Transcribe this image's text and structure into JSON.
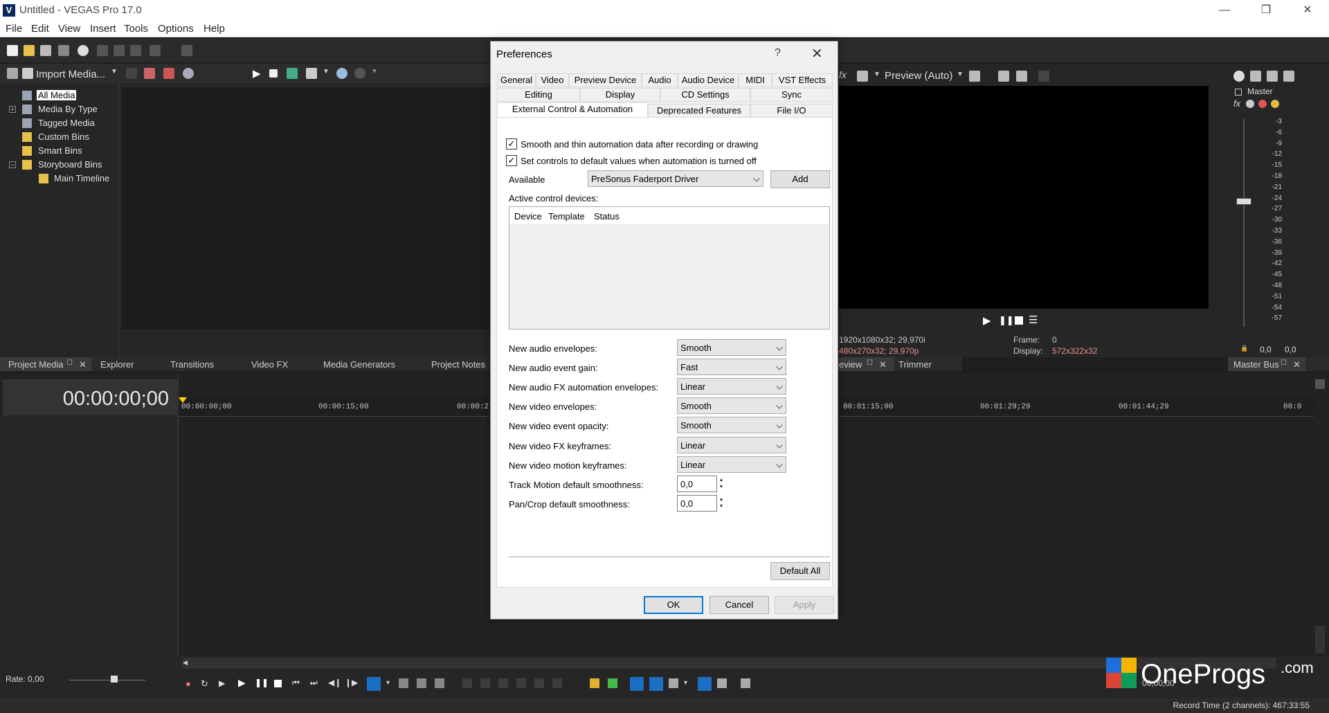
{
  "window": {
    "title": "Untitled - VEGAS Pro 17.0",
    "logo": "V"
  },
  "window_controls": {
    "minimize": "—",
    "maximize": "❐",
    "close": "✕"
  },
  "menu": [
    "File",
    "Edit",
    "View",
    "Insert",
    "Tools",
    "Options",
    "Help"
  ],
  "media_panel": {
    "import_label": "Import Media...",
    "tree": [
      {
        "label": "All Media",
        "icon": "bin-icon",
        "selected": true
      },
      {
        "label": "Media By Type",
        "icon": "bin-icon",
        "expand": "+"
      },
      {
        "label": "Tagged Media",
        "icon": "bin-icon"
      },
      {
        "label": "Custom Bins",
        "icon": "folder-icon"
      },
      {
        "label": "Smart Bins",
        "icon": "folder-icon"
      },
      {
        "label": "Storyboard Bins",
        "icon": "folder-icon",
        "expand": "−"
      },
      {
        "label": "Main Timeline",
        "icon": "folder-icon"
      }
    ]
  },
  "dock_tabs": [
    "Project Media",
    "Explorer",
    "Transitions",
    "Video FX",
    "Media Generators",
    "Project Notes"
  ],
  "preview": {
    "label": "Preview (Auto)",
    "info_left_1": "1920x1080x32; 29,970i",
    "info_left_2": "480x270x32; 29,970p",
    "frame_label": "Frame:",
    "frame_value": "0",
    "display_label": "Display:",
    "display_value": "572x322x32",
    "tabs": [
      "eview",
      "Trimmer"
    ]
  },
  "master": {
    "label": "Master",
    "scale": [
      "3",
      "6",
      "9",
      "12",
      "15",
      "18",
      "21",
      "24",
      "27",
      "30",
      "33",
      "36",
      "39",
      "42",
      "45",
      "48",
      "51",
      "54",
      "57"
    ],
    "left_value": "0,0",
    "right_value": "0,0",
    "tab": "Master Bus"
  },
  "timeline": {
    "timecode": "00:00:00;00",
    "ruler": [
      "00:00:00;00",
      "00:00:15;00",
      "00:00:2",
      "00:01:15;00",
      "00:01:29;29",
      "00:01:44;29",
      "00:0"
    ],
    "rate": "Rate: 0,00",
    "record_time": "Record Time (2 channels): 467:33:55",
    "overlay_time": "00;00;00"
  },
  "watermark": {
    "text": "OneProgs",
    "suffix": ".com"
  },
  "dialog": {
    "title": "Preferences",
    "help": "?",
    "close": "✕",
    "tabs_row1": [
      "General",
      "Video",
      "Preview Device",
      "Audio",
      "Audio Device",
      "MIDI",
      "VST Effects"
    ],
    "tabs_row2": [
      "Editing",
      "Display",
      "CD Settings",
      "Sync"
    ],
    "tabs_row3": [
      "External Control & Automation",
      "Deprecated Features",
      "File I/O"
    ],
    "check1": "Smooth and thin automation data after recording or drawing",
    "check2": "Set controls to default values when automation is turned off",
    "check_mark": "✓",
    "available_label": "Available",
    "available_value": "PreSonus Faderport Driver",
    "add_button": "Add",
    "active_label": "Active control devices:",
    "columns": [
      "Device",
      "Template",
      "Status"
    ],
    "settings": [
      {
        "label": "New audio envelopes:",
        "value": "Smooth"
      },
      {
        "label": "New audio event gain:",
        "value": "Fast"
      },
      {
        "label": "New audio FX automation envelopes:",
        "value": "Linear"
      },
      {
        "label": "New video envelopes:",
        "value": "Smooth"
      },
      {
        "label": "New video event opacity:",
        "value": "Smooth"
      },
      {
        "label": "New video FX keyframes:",
        "value": "Linear"
      },
      {
        "label": "New video motion keyframes:",
        "value": "Linear"
      }
    ],
    "spins": [
      {
        "label": "Track Motion default smoothness:",
        "value": "0,0"
      },
      {
        "label": "Pan/Crop default smoothness:",
        "value": "0,0"
      }
    ],
    "default_all": "Default All",
    "ok": "OK",
    "cancel": "Cancel",
    "apply": "Apply"
  }
}
